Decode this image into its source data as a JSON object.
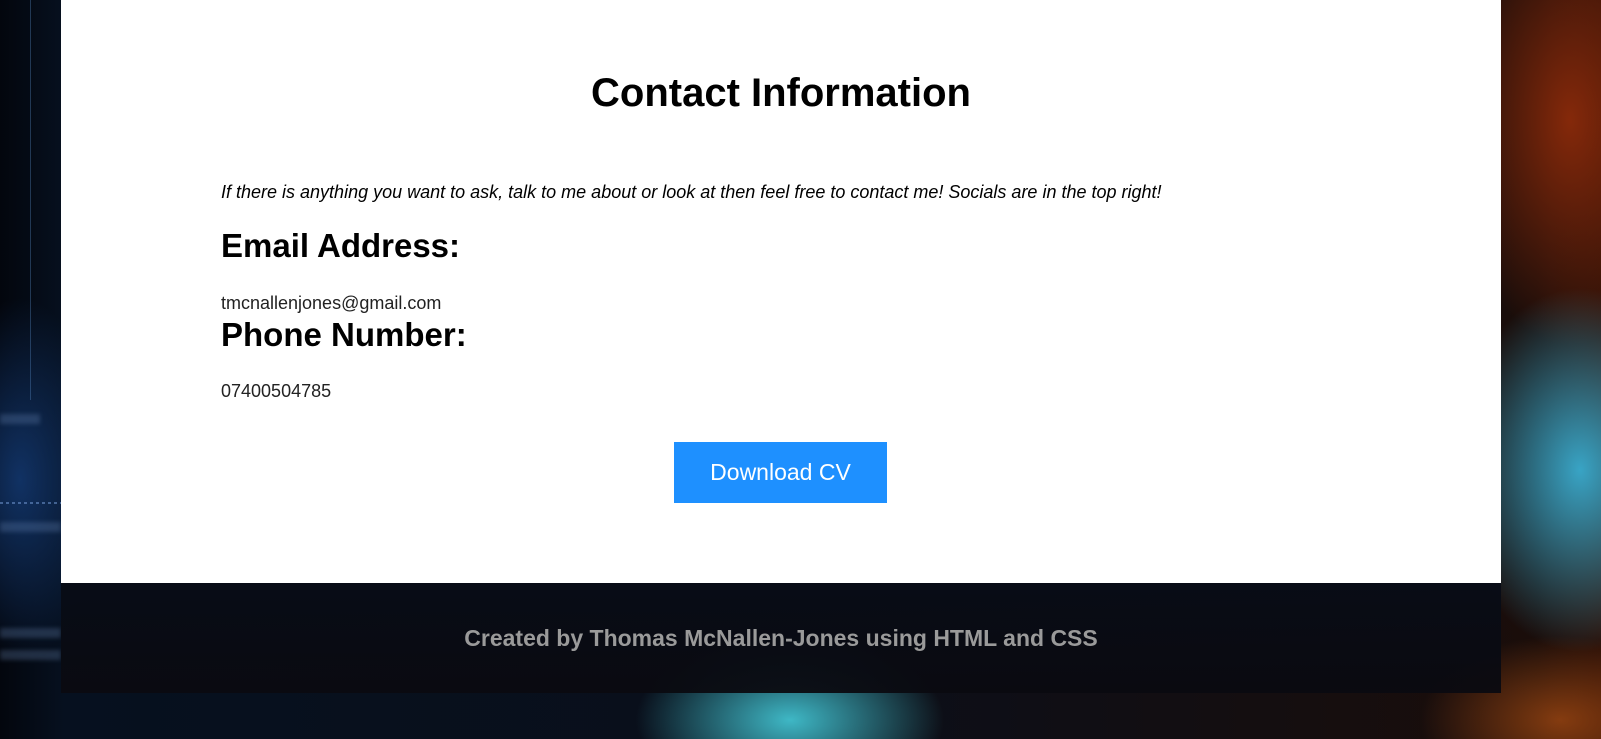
{
  "contact": {
    "title": "Contact Information",
    "intro": "If there is anything you want to ask, talk to me about or look at then feel free to contact me! Socials are in the top right!",
    "email_heading": "Email Address:",
    "email_value": "tmcnallenjones@gmail.com",
    "phone_heading": "Phone Number:",
    "phone_value": "07400504785",
    "download_label": "Download CV"
  },
  "footer": {
    "text": "Created by Thomas McNallen-Jones using HTML and CSS"
  },
  "colors": {
    "button": "#1e90ff",
    "footer_text": "#9a9a9a",
    "card": "#ffffff"
  }
}
